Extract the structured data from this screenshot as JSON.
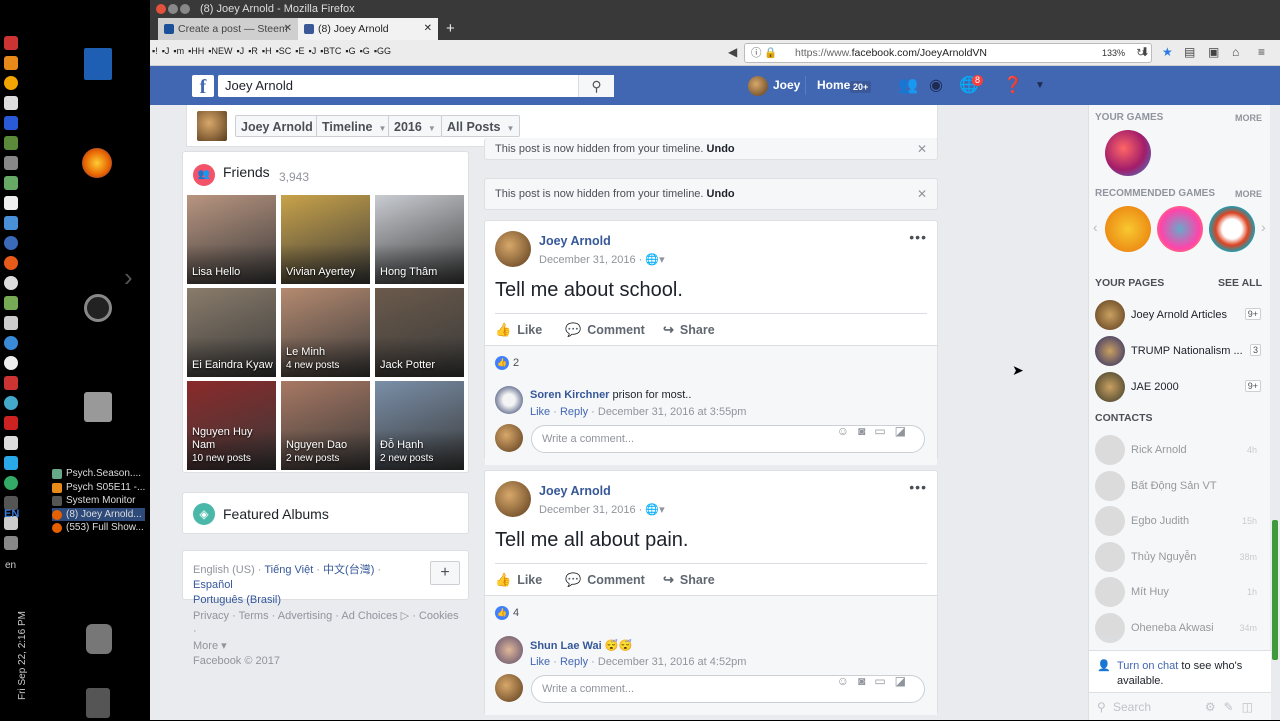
{
  "desktop": {
    "clock": "Fri Sep 22,  2:16 PM",
    "lang": "EN",
    "en_label": "en",
    "windows": [
      "Psych.Season....",
      "Psych S05E11 -...",
      "System Monitor",
      "(8) Joey Arnold...",
      "(553) Full Show..."
    ]
  },
  "browser": {
    "window_title": "(8) Joey Arnold - Mozilla Firefox",
    "tabs": [
      {
        "label": "Create a post — Steem",
        "active": false
      },
      {
        "label": "(8) Joey Arnold",
        "active": true
      }
    ],
    "url_prefix": "https://www.",
    "url": "https://www.facebook.com/JoeyArnoldVN",
    "url_host": "facebook.com/JoeyArnoldVN",
    "zoom": "133%",
    "bookmarks": [
      "!",
      "J",
      "m",
      "HH",
      "NEW",
      "J",
      "R",
      "H",
      "SC",
      "E",
      "J",
      "BTC",
      "G",
      "G",
      "GG"
    ]
  },
  "fb": {
    "search_value": "Joey Arnold",
    "user_name": "Joey",
    "home_label": "Home",
    "home_badge": "20+",
    "notif_badge": "8",
    "timeline_bar": {
      "name_btn": "Joey Arnold",
      "timeline_btn": "Timeline",
      "year_btn": "2016",
      "posts_btn": "All Posts"
    },
    "friends": {
      "title": "Friends",
      "count": "3,943",
      "list": [
        {
          "name": "Lisa Hello",
          "sub": "",
          "color": "#b99580"
        },
        {
          "name": "Vivian Ayertey",
          "sub": "",
          "color": "#c9a34a"
        },
        {
          "name": "Hong Thâm",
          "sub": "",
          "color": "#c9ccd1"
        },
        {
          "name": "Ei Eaindra Kyaw",
          "sub": "",
          "color": "#8a7c6b"
        },
        {
          "name": "Le Minh",
          "sub": "4 new posts",
          "color": "#b58a70"
        },
        {
          "name": "Jack Potter",
          "sub": "",
          "color": "#6b5a4b"
        },
        {
          "name": "Nguyen Huy Nam",
          "sub": "10 new posts",
          "color": "#8b2a2a"
        },
        {
          "name": "Nguyen Dao",
          "sub": "2 new posts",
          "color": "#a87863"
        },
        {
          "name": "Đỗ Hạnh",
          "sub": "2 new posts",
          "color": "#7a8fa8"
        }
      ]
    },
    "featured_albums": "Featured Albums",
    "languages": {
      "current": "English (US)",
      "others": [
        "Tiếng Việt",
        "中文(台灣)",
        "Español",
        "Português (Brasil)"
      ],
      "sep": " · ",
      "plus": "+"
    },
    "footer": {
      "links": [
        "Privacy",
        "Terms",
        "Advertising",
        "Ad Choices",
        "Cookies",
        "More"
      ],
      "copyright": "Facebook © 2017"
    },
    "hidden_notice": "This post is now hidden from your timeline.",
    "hidden_undo": "Undo",
    "posts": [
      {
        "author": "Joey Arnold",
        "date": "December 31, 2016",
        "text": "Tell me about school.",
        "likes": "2",
        "comment": {
          "author": "Soren Kirchner",
          "text": "prison for most..",
          "time": "December 31, 2016 at 3:55pm"
        }
      },
      {
        "author": "Joey Arnold",
        "date": "December 31, 2016",
        "text": "Tell me all about pain.",
        "likes": "4",
        "comment": {
          "author": "Shun Lae Wai",
          "text": "😴😴",
          "time": "December 31, 2016 at 4:52pm"
        }
      }
    ],
    "actions": {
      "like": "Like",
      "comment": "Comment",
      "share": "Share",
      "reply": "Reply"
    },
    "write_comment": "Write a comment...",
    "right": {
      "your_games": "YOUR GAMES",
      "recommended_games": "RECOMMENDED GAMES",
      "more": "MORE",
      "your_pages": "YOUR PAGES",
      "see_all": "SEE ALL",
      "pages": [
        {
          "name": "Joey Arnold Articles",
          "count": "9+"
        },
        {
          "name": "TRUMP Nationalism ...",
          "count": "3"
        },
        {
          "name": "JAE 2000",
          "count": "9+"
        }
      ],
      "contacts_title": "CONTACTS",
      "contacts": [
        {
          "name": "Rick Arnold",
          "time": "4h"
        },
        {
          "name": "Bất Động Sản VT",
          "time": ""
        },
        {
          "name": "Egbo Judith",
          "time": "15h"
        },
        {
          "name": "Thủy Nguyễn",
          "time": "38m"
        },
        {
          "name": "Mít Huy",
          "time": "1h"
        },
        {
          "name": "Oheneba Akwasi",
          "time": "34m"
        }
      ],
      "chat_link": "Turn on chat",
      "chat_text": "to see who's available.",
      "search_placeholder": "Search"
    }
  }
}
